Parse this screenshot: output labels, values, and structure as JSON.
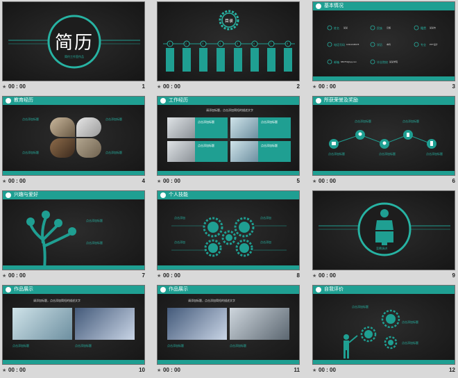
{
  "slides": [
    {
      "id": 1,
      "number": "1",
      "time": "00 : 00",
      "title": "简历",
      "subtitle": "简约工作室作品"
    },
    {
      "id": 2,
      "number": "2",
      "time": "00 : 00",
      "title": "目录",
      "items": [
        "1",
        "2",
        "3",
        "4",
        "5",
        "6",
        "7",
        "8"
      ]
    },
    {
      "id": 3,
      "number": "3",
      "time": "00 : 00",
      "header": "基本情况",
      "fields": [
        {
          "label": "姓名",
          "value": "某某"
        },
        {
          "label": "民族",
          "value": "汉族"
        },
        {
          "label": "籍贯",
          "value": "某某市"
        },
        {
          "label": "电话号码",
          "value": "13312345678"
        },
        {
          "label": "学历",
          "value": "本科"
        },
        {
          "label": "专业",
          "value": "PPT设计"
        },
        {
          "label": "邮箱",
          "value": "686753@qq.com"
        },
        {
          "label": "毕业院校",
          "value": "某某学院"
        }
      ]
    },
    {
      "id": 4,
      "number": "4",
      "time": "00 : 00",
      "header": "教育经历",
      "cards": [
        "点击添加标题",
        "点击添加标题",
        "点击添加标题",
        "点击添加标题"
      ]
    },
    {
      "id": 5,
      "number": "5",
      "time": "00 : 00",
      "header": "工作经历",
      "intro": "请添加标题，点击添加简短的描述文字",
      "cards": [
        "点击添加标题",
        "点击添加标题",
        "点击添加标题",
        "点击添加标题"
      ]
    },
    {
      "id": 6,
      "number": "6",
      "time": "00 : 00",
      "header": "所获荣誉及奖励",
      "cards": [
        "点击添加标题",
        "点击添加标题",
        "点击添加标题",
        "点击添加标题",
        "点击添加标题"
      ]
    },
    {
      "id": 7,
      "number": "7",
      "time": "00 : 00",
      "header": "兴趣与爱好",
      "cards": [
        "点击添加标题",
        "点击添加标题"
      ]
    },
    {
      "id": 8,
      "number": "8",
      "time": "00 : 00",
      "header": "个人技能",
      "cards": [
        "点击添加",
        "点击添加",
        "点击添加",
        "点击添加"
      ]
    },
    {
      "id": 9,
      "number": "9",
      "time": "00 : 00",
      "caption": "竞聘演讲"
    },
    {
      "id": 10,
      "number": "10",
      "time": "00 : 00",
      "header": "作品展示",
      "intro": "请添加标题，点击添加简短的描述文字",
      "cards": [
        "点击添加标题",
        "点击添加标题"
      ]
    },
    {
      "id": 11,
      "number": "11",
      "time": "00 : 00",
      "header": "作品展示",
      "intro": "请添加标题，点击添加简短的描述文字",
      "cards": [
        "点击添加标题",
        "点击添加标题"
      ]
    },
    {
      "id": 12,
      "number": "12",
      "time": "00 : 00",
      "header": "自我评价",
      "cards": [
        "点击添加标题",
        "点击添加标题",
        "点击添加标题"
      ]
    }
  ],
  "colors": {
    "accent": "#1f9f92",
    "background": "#d9d9d9",
    "slide_bg": "#1d1d1d"
  }
}
